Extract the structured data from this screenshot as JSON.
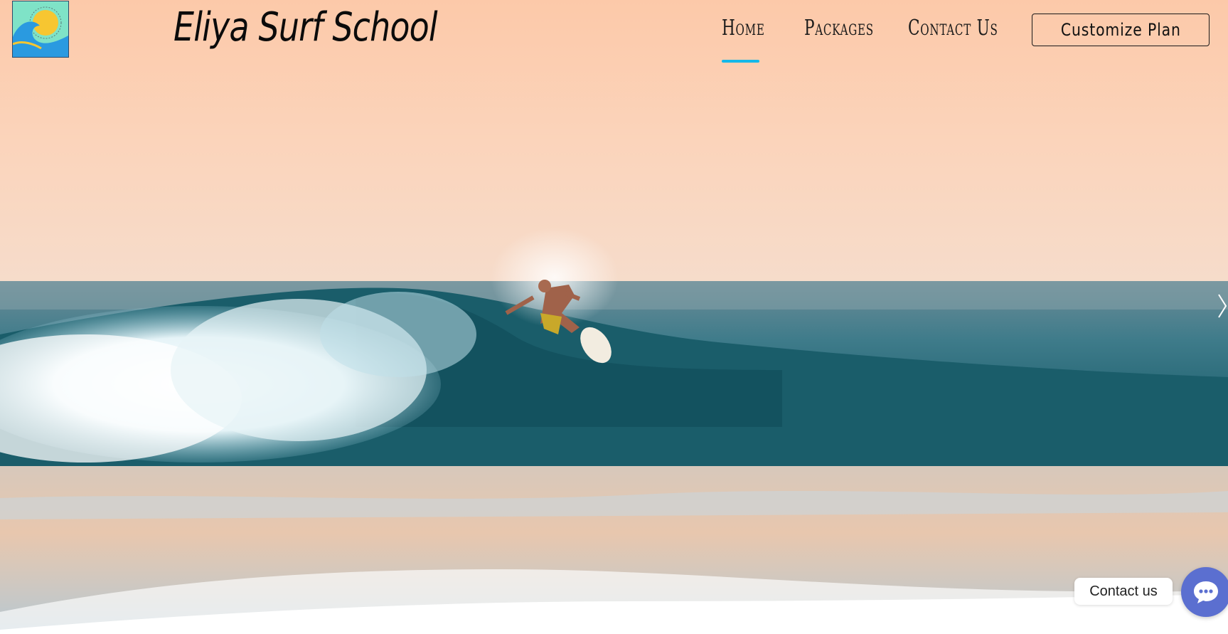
{
  "header": {
    "site_title": "Eliya Surf School",
    "logo": "wave-sun-logo"
  },
  "nav": {
    "items": [
      {
        "label": "Home",
        "active": true
      },
      {
        "label": "Packages",
        "active": false
      },
      {
        "label": "Contact Us",
        "active": false
      }
    ],
    "cta_label": "Customize  Plan"
  },
  "contact_widget": {
    "label": "Contact us",
    "icon": "chat-bubble-icon"
  },
  "colors": {
    "active_underline": "#16b8e8",
    "chat_button": "#5b6fd0"
  }
}
